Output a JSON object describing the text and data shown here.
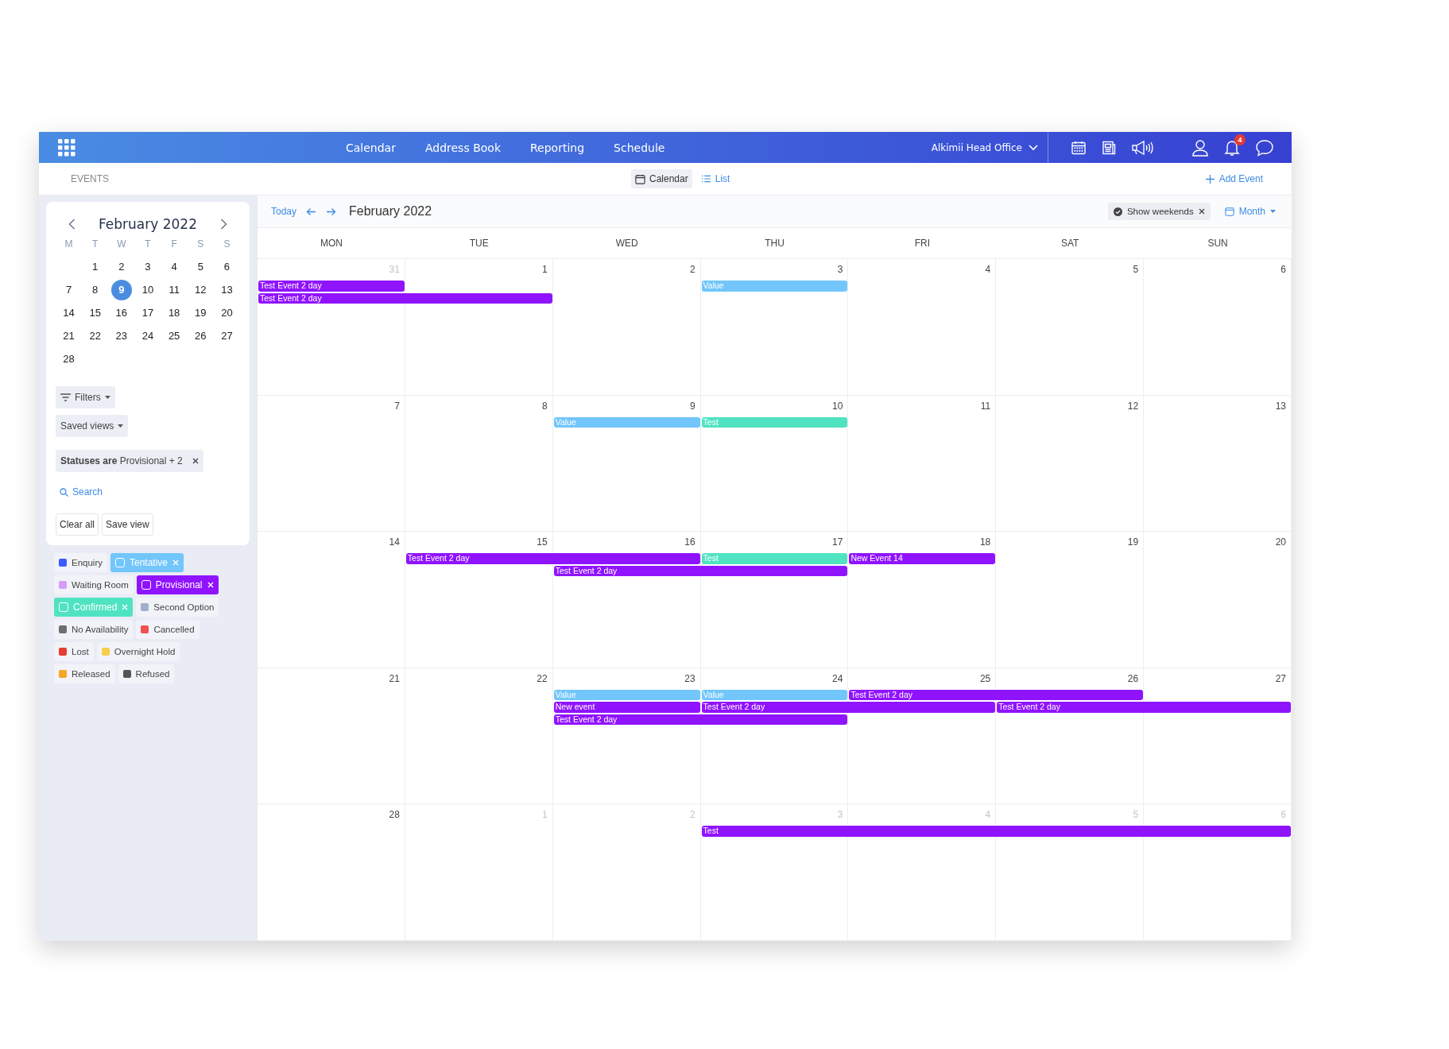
{
  "top_nav": {
    "items": [
      {
        "label": "Calendar"
      },
      {
        "label": "Address Book"
      },
      {
        "label": "Reporting"
      },
      {
        "label": "Schedule"
      }
    ],
    "office": "Alkimii Head Office",
    "notification_count": "4"
  },
  "toolbar": {
    "section": "EVENTS",
    "views": [
      {
        "label": "Calendar",
        "selected": true
      },
      {
        "label": "List",
        "selected": false
      }
    ],
    "add_event": "Add Event"
  },
  "mini_calendar": {
    "title": "February 2022",
    "weekdays": [
      "M",
      "T",
      "W",
      "T",
      "F",
      "S",
      "S"
    ],
    "weeks": [
      [
        {
          "label": "1",
          "selected": false
        },
        {
          "label": "2",
          "selected": false
        },
        {
          "label": "3",
          "selected": false
        },
        {
          "label": "4",
          "selected": false
        },
        {
          "label": "5",
          "selected": false
        },
        {
          "label": "6",
          "selected": false
        }
      ],
      [
        {
          "label": "7",
          "selected": false
        },
        {
          "label": "8",
          "selected": false
        },
        {
          "label": "9",
          "selected": true
        },
        {
          "label": "10",
          "selected": false
        },
        {
          "label": "11",
          "selected": false
        },
        {
          "label": "12",
          "selected": false
        },
        {
          "label": "13",
          "selected": false
        }
      ],
      [
        {
          "label": "14",
          "selected": false
        },
        {
          "label": "15",
          "selected": false
        },
        {
          "label": "16",
          "selected": false
        },
        {
          "label": "17",
          "selected": false
        },
        {
          "label": "18",
          "selected": false
        },
        {
          "label": "19",
          "selected": false
        },
        {
          "label": "20",
          "selected": false
        }
      ],
      [
        {
          "label": "21",
          "selected": false
        },
        {
          "label": "22",
          "selected": false
        },
        {
          "label": "23",
          "selected": false
        },
        {
          "label": "24",
          "selected": false
        },
        {
          "label": "25",
          "selected": false
        },
        {
          "label": "26",
          "selected": false
        },
        {
          "label": "27",
          "selected": false
        }
      ],
      [
        {
          "label": "28",
          "selected": false
        }
      ]
    ]
  },
  "filters": {
    "filters_button": "Filters",
    "saved_views": "Saved views",
    "active_filter": "**Statuses are** Provisional + 2",
    "search": "Search",
    "clear_all": "Clear all",
    "save_view": "Save view"
  },
  "statuses": [
    {
      "label": "Enquiry",
      "color": "#3d5afe",
      "active": false
    },
    {
      "label": "Tentative",
      "color": "#72c6fb",
      "active": true
    },
    {
      "label": "Waiting Room",
      "color": "#d59cfa",
      "active": false
    },
    {
      "label": "Provisional",
      "color": "#9013fe",
      "active": true
    },
    {
      "label": "Confirmed",
      "color": "#50e3c2",
      "active": true
    },
    {
      "label": "Second Option",
      "color": "#a1aecb",
      "active": false
    },
    {
      "label": "No Availability",
      "color": "#6f6f6f",
      "active": false
    },
    {
      "label": "Cancelled",
      "color": "#ef5350",
      "active": false
    },
    {
      "label": "Lost",
      "color": "#e53e2f",
      "active": false
    },
    {
      "label": "Overnight Hold",
      "color": "#f5d04a",
      "active": false
    },
    {
      "label": "Released",
      "color": "#f6a623",
      "active": false
    },
    {
      "label": "Refused",
      "color": "#555555",
      "active": false
    }
  ],
  "calendar": {
    "today": "Today",
    "title": "February 2022",
    "show_weekends": {
      "label": "Show weekends",
      "checked": true
    },
    "view": "Month",
    "day_names": [
      "MON",
      "TUE",
      "WED",
      "THU",
      "FRI",
      "SAT",
      "SUN"
    ],
    "weeks": [
      {
        "days": [
          {
            "label": "31",
            "muted": true
          },
          {
            "label": "1",
            "muted": false
          },
          {
            "label": "2",
            "muted": false
          },
          {
            "label": "3",
            "muted": false
          },
          {
            "label": "4",
            "muted": false
          },
          {
            "label": "5",
            "muted": false
          },
          {
            "label": "6",
            "muted": false
          }
        ],
        "events": [
          {
            "title": "Test Event 2 day",
            "color": "#9013fe"
          },
          {
            "title": "Test Event 2 day",
            "color": "#9013fe"
          },
          {
            "title": "Value",
            "color": "#72c6fb"
          }
        ]
      },
      {
        "days": [
          {
            "label": "7",
            "muted": false
          },
          {
            "label": "8",
            "muted": false
          },
          {
            "label": "9",
            "muted": false
          },
          {
            "label": "10",
            "muted": false
          },
          {
            "label": "11",
            "muted": false
          },
          {
            "label": "12",
            "muted": false
          },
          {
            "label": "13",
            "muted": false
          }
        ],
        "events": [
          {
            "title": "Value",
            "color": "#72c6fb"
          },
          {
            "title": "Test",
            "color": "#50e3c2"
          }
        ]
      },
      {
        "days": [
          {
            "label": "14",
            "muted": false
          },
          {
            "label": "15",
            "muted": false
          },
          {
            "label": "16",
            "muted": false
          },
          {
            "label": "17",
            "muted": false
          },
          {
            "label": "18",
            "muted": false
          },
          {
            "label": "19",
            "muted": false
          },
          {
            "label": "20",
            "muted": false
          }
        ],
        "events": [
          {
            "title": "Test Event 2 day",
            "color": "#9013fe"
          },
          {
            "title": "Test",
            "color": "#50e3c2"
          },
          {
            "title": "New Event 14",
            "color": "#9013fe"
          },
          {
            "title": "Test Event 2 day",
            "color": "#9013fe"
          }
        ]
      },
      {
        "days": [
          {
            "label": "21",
            "muted": false
          },
          {
            "label": "22",
            "muted": false
          },
          {
            "label": "23",
            "muted": false
          },
          {
            "label": "24",
            "muted": false
          },
          {
            "label": "25",
            "muted": false
          },
          {
            "label": "26",
            "muted": false
          },
          {
            "label": "27",
            "muted": false
          }
        ],
        "events": [
          {
            "title": "Value",
            "color": "#72c6fb"
          },
          {
            "title": "Value",
            "color": "#72c6fb"
          },
          {
            "title": "Test Event 2 day",
            "color": "#9013fe"
          },
          {
            "title": "New event",
            "color": "#9013fe"
          },
          {
            "title": "Test Event 2 day",
            "color": "#9013fe"
          },
          {
            "title": "Test Event 2 day",
            "color": "#9013fe"
          },
          {
            "title": "Test Event 2 day",
            "color": "#9013fe"
          }
        ]
      },
      {
        "days": [
          {
            "label": "28",
            "muted": false
          },
          {
            "label": "1",
            "muted": true
          },
          {
            "label": "2",
            "muted": true
          },
          {
            "label": "3",
            "muted": true
          },
          {
            "label": "4",
            "muted": true
          },
          {
            "label": "5",
            "muted": true
          },
          {
            "label": "6",
            "muted": true
          }
        ],
        "events": [
          {
            "title": "Test",
            "color": "#9013fe"
          }
        ]
      }
    ]
  }
}
